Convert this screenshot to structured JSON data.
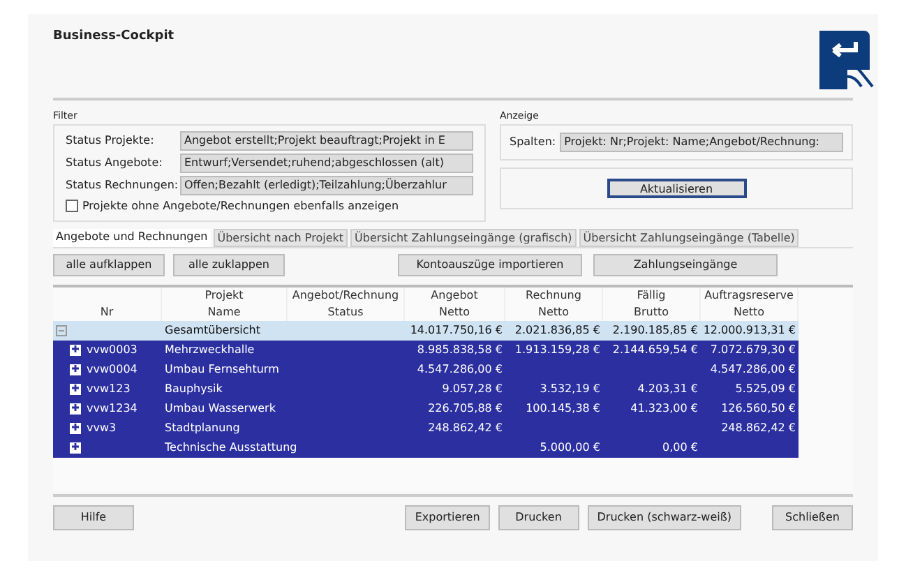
{
  "window": {
    "title": "Business-Cockpit"
  },
  "filter": {
    "title": "Filter",
    "fields": [
      {
        "label": "Status Projekte:",
        "value": "Angebot erstellt;Projekt beauftragt;Projekt in E"
      },
      {
        "label": "Status Angebote:",
        "value": "Entwurf;Versendet;ruhend;abgeschlossen (alt)"
      },
      {
        "label": "Status Rechnungen:",
        "value": "Offen;Bezahlt (erledigt);Teilzahlung;Überzahlur"
      }
    ],
    "checkbox": {
      "label": "Projekte ohne Angebote/Rechnungen ebenfalls anzeigen",
      "checked": false
    }
  },
  "anzeige": {
    "title": "Anzeige",
    "label": "Spalten:",
    "value": "Projekt: Nr;Projekt: Name;Angebot/Rechnung:",
    "button": "Aktualisieren"
  },
  "tabs": [
    {
      "label": "Angebote und Rechnungen",
      "selected": true
    },
    {
      "label": "Übersicht nach Projekt",
      "selected": false
    },
    {
      "label": "Übersicht Zahlungseingänge (grafisch)",
      "selected": false
    },
    {
      "label": "Übersicht Zahlungseingänge (Tabelle)",
      "selected": false
    }
  ],
  "toolbar": {
    "left": [
      "alle aufklappen",
      "alle zuklappen"
    ],
    "right": [
      "Kontoauszüge importieren",
      "Zahlungseingänge"
    ]
  },
  "table": {
    "columns": [
      {
        "label": "Nr"
      },
      {
        "group": "Projekt",
        "label": "Name"
      },
      {
        "group": "Angebot/Rechnung",
        "label": "Status"
      },
      {
        "group": "Angebot",
        "label": "Netto"
      },
      {
        "group": "Rechnung",
        "label": "Netto"
      },
      {
        "group": "Fällig",
        "label": "Brutto"
      },
      {
        "group": "Auftragsreserve",
        "label": "Netto"
      }
    ],
    "rows": [
      {
        "expanded": true,
        "selected": false,
        "cells": [
          "",
          "Gesamtübersicht",
          "",
          "14.017.750,16 €",
          "2.021.836,85 €",
          "2.190.185,85 €",
          "12.000.913,31 €"
        ],
        "children": [
          {
            "expanded": false,
            "selected": true,
            "cells": [
              "vvw0003",
              "Mehrzweckhalle",
              "",
              "8.985.838,58 €",
              "1.913.159,28 €",
              "2.144.659,54 €",
              "7.072.679,30 €"
            ]
          },
          {
            "expanded": false,
            "selected": true,
            "cells": [
              "vvw0004",
              "Umbau Fernsehturm",
              "",
              "4.547.286,00 €",
              "",
              "",
              "4.547.286,00 €"
            ]
          },
          {
            "expanded": false,
            "selected": true,
            "cells": [
              "vvw123",
              "Bauphysik",
              "",
              "9.057,28 €",
              "3.532,19 €",
              "4.203,31 €",
              "5.525,09 €"
            ]
          },
          {
            "expanded": false,
            "selected": true,
            "cells": [
              "vvw1234",
              "Umbau Wasserwerk",
              "",
              "226.705,88 €",
              "100.145,38 €",
              "41.323,00 €",
              "126.560,50 €"
            ]
          },
          {
            "expanded": false,
            "selected": true,
            "cells": [
              "vvw3",
              "Stadtplanung",
              "",
              "248.862,42 €",
              "",
              "",
              "248.862,42 €"
            ]
          },
          {
            "expanded": false,
            "selected": true,
            "cells": [
              "",
              "Technische Ausstattung",
              "",
              "",
              "5.000,00 €",
              "0,00 €",
              ""
            ]
          }
        ]
      }
    ]
  },
  "footer": {
    "left": [
      "Hilfe"
    ],
    "middle": [
      "Exportieren",
      "Drucken",
      "Drucken (schwarz-weiß)"
    ],
    "right": [
      "Schließen"
    ]
  }
}
